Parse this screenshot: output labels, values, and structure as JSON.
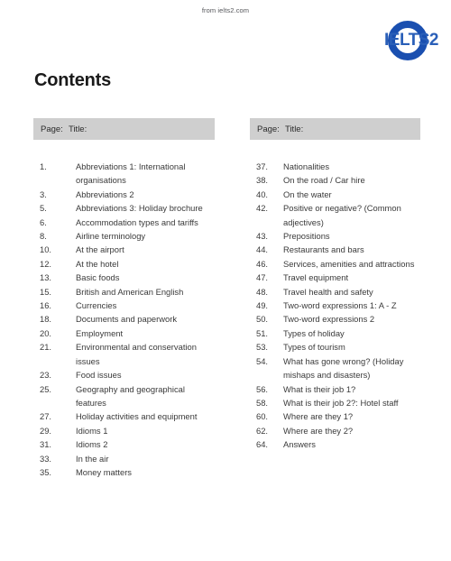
{
  "source_note": "from ielts2.com",
  "logo": {
    "text": "IELTS2",
    "ring_color": "#1a4fb0",
    "text_color": "#2a5fb8"
  },
  "page_title": "Contents",
  "columns": [
    {
      "header": {
        "page_label": "Page:",
        "title_label": "Title:"
      },
      "entries": [
        {
          "page": "1.",
          "title": "Abbreviations 1: International organisations"
        },
        {
          "page": "3.",
          "title": "Abbreviations 2"
        },
        {
          "page": "5.",
          "title": "Abbreviations 3: Holiday brochure"
        },
        {
          "page": "6.",
          "title": "Accommodation types and tariffs"
        },
        {
          "page": "8.",
          "title": "Airline terminology"
        },
        {
          "page": "10.",
          "title": "At the airport"
        },
        {
          "page": "12.",
          "title": "At the hotel"
        },
        {
          "page": "13.",
          "title": "Basic foods"
        },
        {
          "page": "15.",
          "title": "British and American English"
        },
        {
          "page": "16.",
          "title": "Currencies"
        },
        {
          "page": "18.",
          "title": "Documents and paperwork"
        },
        {
          "page": "20.",
          "title": "Employment"
        },
        {
          "page": "21.",
          "title": "Environmental and conservation issues"
        },
        {
          "page": "23.",
          "title": "Food issues"
        },
        {
          "page": "25.",
          "title": "Geography and geographical features"
        },
        {
          "page": "27.",
          "title": "Holiday activities and equipment"
        },
        {
          "page": "29.",
          "title": "Idioms 1"
        },
        {
          "page": "31.",
          "title": "Idioms 2"
        },
        {
          "page": "33.",
          "title": "In the air"
        },
        {
          "page": "35.",
          "title": "Money matters"
        }
      ]
    },
    {
      "header": {
        "page_label": "Page:",
        "title_label": "Title:"
      },
      "entries": [
        {
          "page": "37.",
          "title": "Nationalities"
        },
        {
          "page": "38.",
          "title": "On the road / Car hire"
        },
        {
          "page": "40.",
          "title": "On the water"
        },
        {
          "page": "42.",
          "title": "Positive or negative? (Common adjectives)"
        },
        {
          "page": "43.",
          "title": "Prepositions"
        },
        {
          "page": "44.",
          "title": "Restaurants and bars"
        },
        {
          "page": "46.",
          "title": "Services, amenities and attractions"
        },
        {
          "page": "47.",
          "title": "Travel equipment"
        },
        {
          "page": "48.",
          "title": "Travel health and safety"
        },
        {
          "page": "49.",
          "title": "Two-word expressions 1: A - Z"
        },
        {
          "page": "50.",
          "title": "Two-word expressions 2"
        },
        {
          "page": "51.",
          "title": "Types of holiday"
        },
        {
          "page": "53.",
          "title": "Types of tourism"
        },
        {
          "page": "54.",
          "title": "What has gone wrong? (Holiday mishaps and disasters)"
        },
        {
          "page": "56.",
          "title": "What is their job 1?"
        },
        {
          "page": "58.",
          "title": "What is their job 2?: Hotel staff"
        },
        {
          "page": "60.",
          "title": "Where are they 1?"
        },
        {
          "page": "62.",
          "title": "Where are they 2?"
        },
        {
          "page": "64.",
          "title": "Answers"
        }
      ]
    }
  ]
}
